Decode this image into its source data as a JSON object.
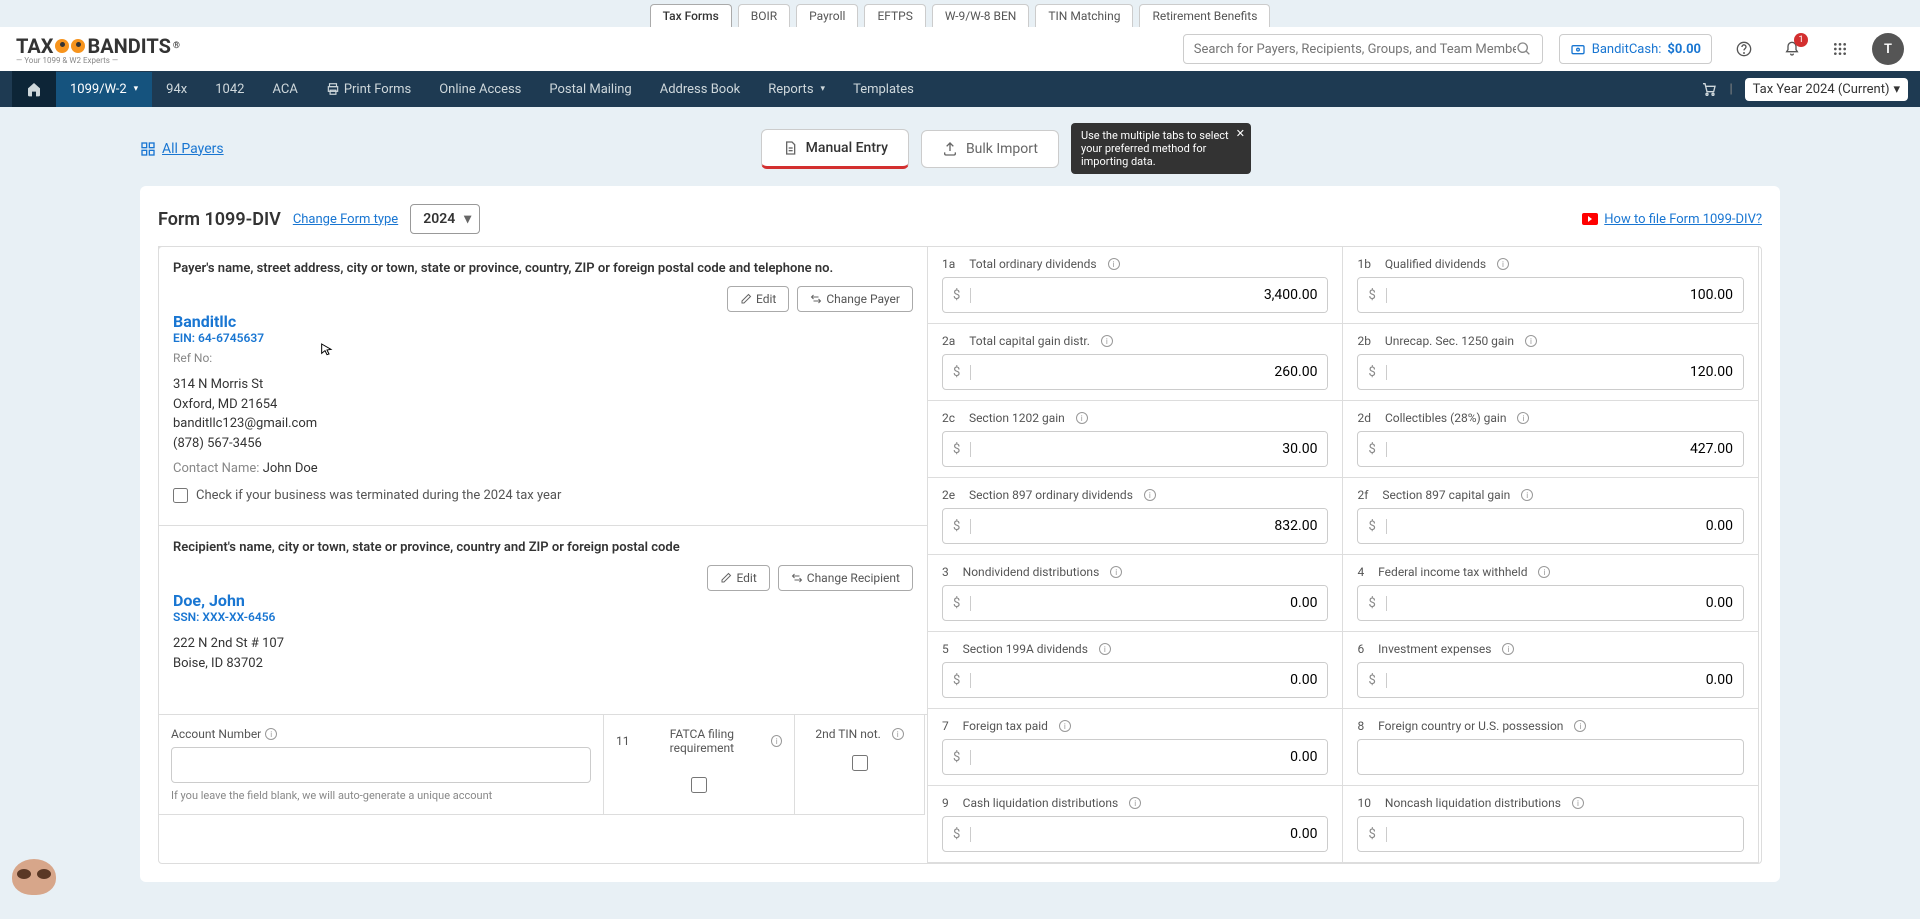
{
  "topTabs": [
    "Tax Forms",
    "BOIR",
    "Payroll",
    "EFTPS",
    "W-9/W-8 BEN",
    "TIN Matching",
    "Retirement Benefits"
  ],
  "topTabActive": 0,
  "logo": {
    "text1": "TAX",
    "text2": "BANDITS",
    "reg": "®",
    "sub": "— Your 1099 & W2 Experts —"
  },
  "search": {
    "placeholder": "Search for Payers, Recipients, Groups, and Team Members"
  },
  "cash": {
    "label": "BanditCash:",
    "value": "$0.00"
  },
  "notif": {
    "count": "1"
  },
  "avatar": {
    "initial": "T"
  },
  "nav": {
    "items": [
      "1099/W-2",
      "94x",
      "1042",
      "ACA",
      "Print Forms",
      "Online Access",
      "Postal Mailing",
      "Address Book",
      "Reports",
      "Templates"
    ],
    "taxYear": "Tax Year 2024 (Current)"
  },
  "allPayers": "All Payers",
  "entryTabs": {
    "manual": "Manual Entry",
    "bulk": "Bulk Import"
  },
  "tooltip": "Use the multiple tabs to select your preferred method for importing data.",
  "formHeader": {
    "title": "Form 1099-DIV",
    "change": "Change Form type",
    "year": "2024",
    "how": "How to file Form 1099-DIV?"
  },
  "payerPanel": {
    "title": "Payer's name, street address, city or town, state or province, country, ZIP or foreign postal code and telephone no.",
    "name": "Banditllc",
    "ein": "EIN: 64-6745637",
    "ref": "Ref No:",
    "addr1": "314 N Morris St",
    "addr2": "Oxford, MD 21654",
    "email": "banditllc123@gmail.com",
    "phone": "(878) 567-3456",
    "contactLabel": "Contact Name: ",
    "contactName": "John Doe",
    "editBtn": "Edit",
    "changeBtn": "Change Payer",
    "terminated": "Check if your business was terminated during the 2024 tax year"
  },
  "recipientPanel": {
    "title": "Recipient's name, city or town, state or province, country and ZIP or foreign postal code",
    "name": "Doe, John",
    "ssn": "SSN: XXX-XX-6456",
    "addr1": "222 N 2nd St # 107",
    "addr2": "Boise, ID 83702",
    "editBtn": "Edit",
    "changeBtn": "Change Recipient"
  },
  "acct": {
    "label": "Account Number",
    "hint": "If you leave the field blank, we will auto-generate a unique account"
  },
  "fatca": {
    "num": "11",
    "label": "FATCA filing requirement"
  },
  "tin2": {
    "label": "2nd TIN not."
  },
  "fields": [
    {
      "num": "1a",
      "label": "Total ordinary dividends",
      "value": "3,400.00"
    },
    {
      "num": "1b",
      "label": "Qualified dividends",
      "value": "100.00"
    },
    {
      "num": "2a",
      "label": "Total capital gain distr.",
      "value": "260.00"
    },
    {
      "num": "2b",
      "label": "Unrecap. Sec. 1250 gain",
      "value": "120.00"
    },
    {
      "num": "2c",
      "label": "Section 1202 gain",
      "value": "30.00"
    },
    {
      "num": "2d",
      "label": "Collectibles (28%) gain",
      "value": "427.00"
    },
    {
      "num": "2e",
      "label": "Section 897 ordinary dividends",
      "value": "832.00"
    },
    {
      "num": "2f",
      "label": "Section 897 capital gain",
      "value": "0.00"
    },
    {
      "num": "3",
      "label": "Nondividend distributions",
      "value": "0.00"
    },
    {
      "num": "4",
      "label": "Federal income tax withheld",
      "value": "0.00"
    },
    {
      "num": "5",
      "label": "Section 199A dividends",
      "value": "0.00"
    },
    {
      "num": "6",
      "label": "Investment expenses",
      "value": "0.00"
    },
    {
      "num": "7",
      "label": "Foreign tax paid",
      "value": "0.00"
    },
    {
      "num": "8",
      "label": "Foreign country or U.S. possession",
      "value": "",
      "text": true
    },
    {
      "num": "9",
      "label": "Cash liquidation distributions",
      "value": "0.00"
    },
    {
      "num": "10",
      "label": "Noncash liquidation distributions",
      "value": ""
    }
  ]
}
